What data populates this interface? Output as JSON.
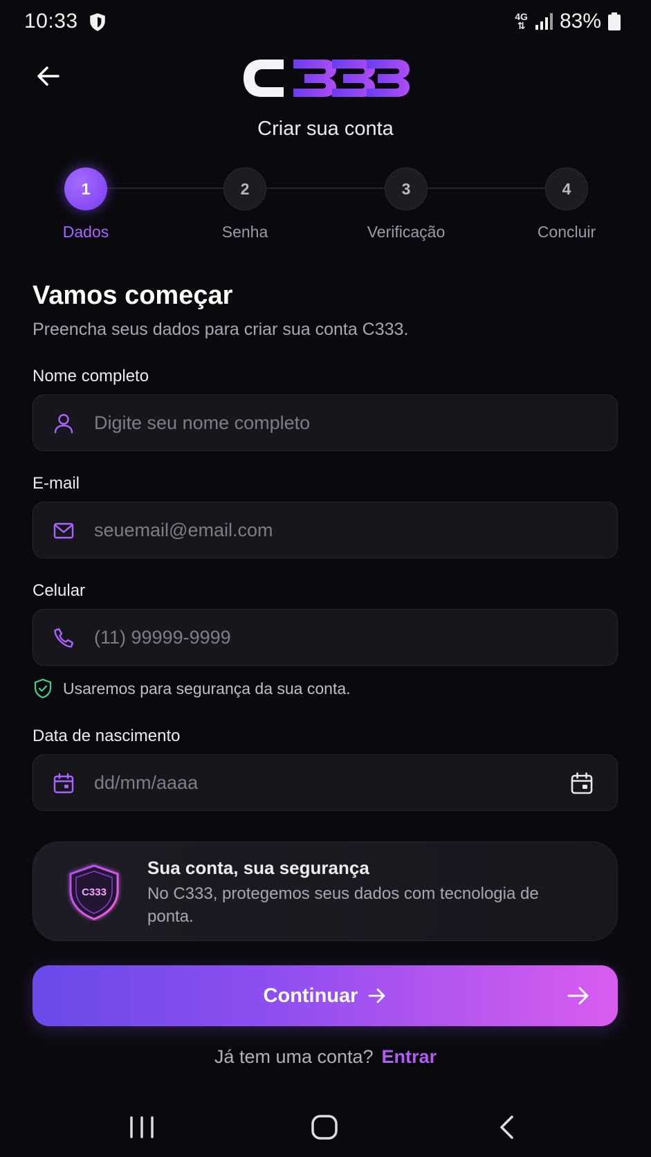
{
  "status_bar": {
    "time": "10:33",
    "network": "4G",
    "battery": "83%"
  },
  "header": {
    "logo_text": "C333",
    "subtitle": "Criar sua conta"
  },
  "stepper": {
    "steps": [
      {
        "number": "1",
        "label": "Dados",
        "active": true
      },
      {
        "number": "2",
        "label": "Senha",
        "active": false
      },
      {
        "number": "3",
        "label": "Verificação",
        "active": false
      },
      {
        "number": "4",
        "label": "Concluir",
        "active": false
      }
    ]
  },
  "intro": {
    "title": "Vamos começar",
    "text": "Preencha seus dados para criar sua conta C333."
  },
  "form": {
    "name": {
      "label": "Nome completo",
      "placeholder": "Digite seu nome completo",
      "value": ""
    },
    "email": {
      "label": "E-mail",
      "placeholder": "seuemail@email.com",
      "value": ""
    },
    "phone": {
      "label": "Celular",
      "placeholder": "(11) 99999-9999",
      "value": "",
      "hint": "Usaremos para segurança da sua conta."
    },
    "birthdate": {
      "label": "Data de nascimento",
      "placeholder": "dd/mm/aaaa",
      "value": ""
    }
  },
  "security_card": {
    "title": "Sua conta, sua segurança",
    "text": "No C333, protegemos seus dados com tecnologia de ponta.",
    "badge_text": "C333"
  },
  "actions": {
    "continue_label": "Continuar",
    "login_prompt": "Já tem uma conta?",
    "login_link": "Entrar"
  },
  "colors": {
    "background": "#0a0a0e",
    "accent": "#a764ff",
    "success": "#3fd08a"
  },
  "icons": {
    "status": "shield-icon",
    "back": "arrow-left-icon",
    "name": "user-icon",
    "email": "mail-icon",
    "phone": "phone-icon",
    "hint": "shield-check-icon",
    "birthdate": "calendar-icon",
    "security": "shield-badge-icon",
    "continue": "arrow-right-icon"
  }
}
